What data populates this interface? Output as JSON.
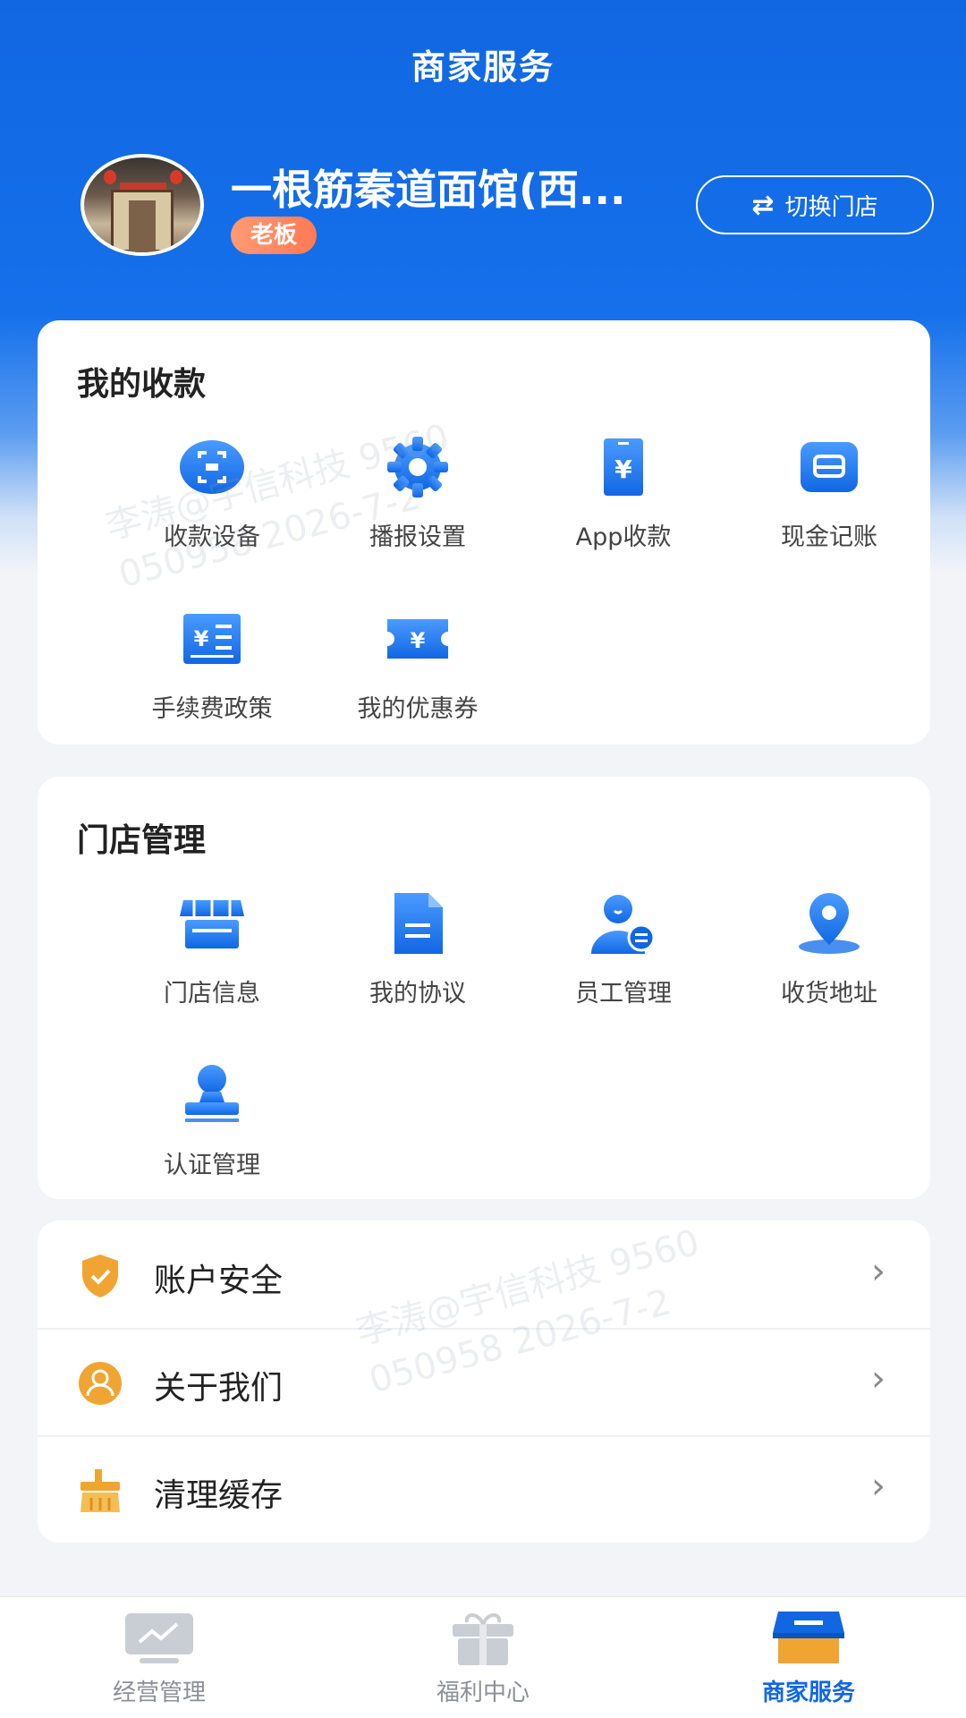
{
  "header": {
    "title": "商家服务"
  },
  "profile": {
    "store_name": "一根筋秦道面馆(西...",
    "role": "老板",
    "switch_label": "切换门店"
  },
  "payments": {
    "title": "我的收款",
    "items": [
      {
        "label": "收款设备",
        "icon": "scan-device-icon"
      },
      {
        "label": "播报设置",
        "icon": "gear-icon"
      },
      {
        "label": "App收款",
        "icon": "yuan-phone-icon"
      },
      {
        "label": "现金记账",
        "icon": "cash-box-icon"
      },
      {
        "label": "手续费政策",
        "icon": "fee-policy-icon"
      },
      {
        "label": "我的优惠券",
        "icon": "coupon-icon"
      }
    ]
  },
  "store": {
    "title": "门店管理",
    "items": [
      {
        "label": "门店信息",
        "icon": "storefront-icon"
      },
      {
        "label": "我的协议",
        "icon": "document-icon"
      },
      {
        "label": "员工管理",
        "icon": "staff-icon"
      },
      {
        "label": "收货地址",
        "icon": "location-pin-icon"
      },
      {
        "label": "认证管理",
        "icon": "stamp-icon"
      }
    ]
  },
  "settings": [
    {
      "label": "账户安全",
      "icon": "shield-check-icon"
    },
    {
      "label": "关于我们",
      "icon": "user-circle-icon"
    },
    {
      "label": "清理缓存",
      "icon": "broom-icon"
    }
  ],
  "tabbar": [
    {
      "label": "经营管理",
      "icon": "chart-monitor-icon",
      "active": false
    },
    {
      "label": "福利中心",
      "icon": "gift-icon",
      "active": false
    },
    {
      "label": "商家服务",
      "icon": "shop-service-icon",
      "active": true
    }
  ],
  "watermark": {
    "line1": "李涛@宇信科技 9560",
    "line2": "050958 2026-7-2"
  },
  "colors": {
    "primary": "#1167e2",
    "accent_orange": "#ff7a55",
    "icon_gold": "#f0a532"
  }
}
